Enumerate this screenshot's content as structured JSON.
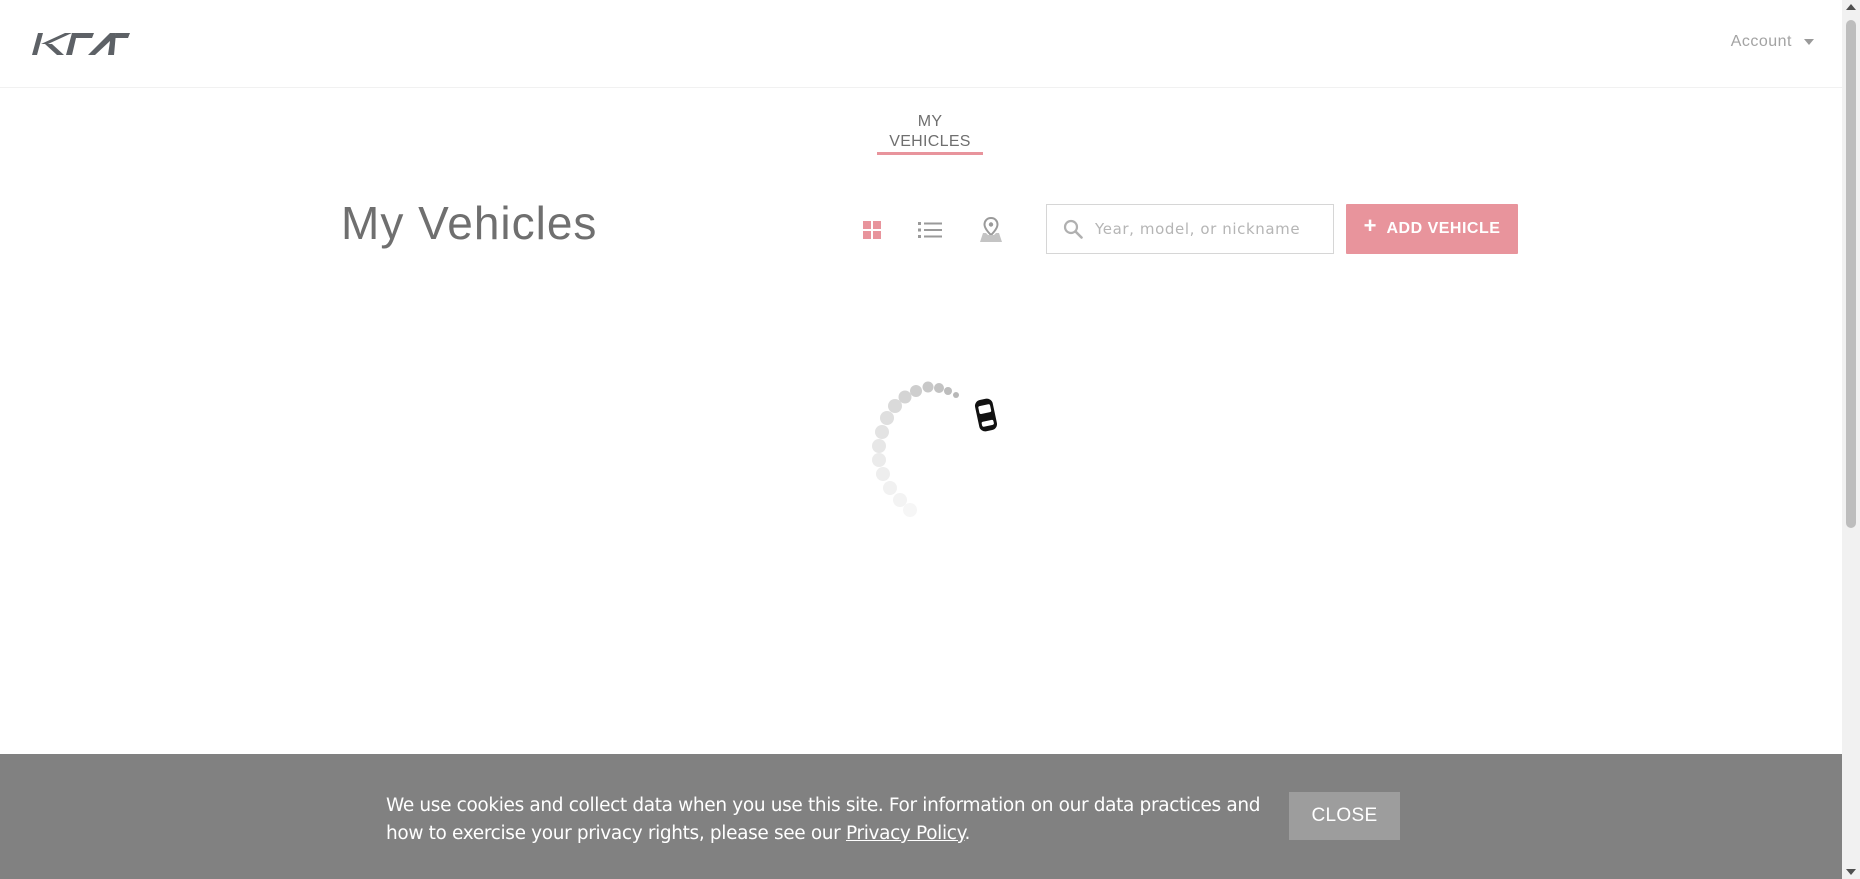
{
  "header": {
    "brand": "KIA",
    "account_label": "Account"
  },
  "tabs": [
    {
      "label": "MY VEHICLES",
      "active": true
    }
  ],
  "main": {
    "title": "My Vehicles",
    "view_modes": [
      {
        "name": "grid-view",
        "icon": "grid-icon",
        "active": true
      },
      {
        "name": "list-view",
        "icon": "list-icon",
        "active": false
      },
      {
        "name": "map-view",
        "icon": "map-pin-icon",
        "active": false
      }
    ],
    "search": {
      "placeholder": "Year, model, or nickname",
      "value": ""
    },
    "add_vehicle": {
      "icon": "+",
      "label": "ADD VEHICLE"
    },
    "loading": true
  },
  "cookie_banner": {
    "text_before_link": "We use cookies and collect data when you use this site. For information on our data practices and how to exercise your privacy rights, please see our ",
    "link_text": "Privacy Policy",
    "text_after_link": ".",
    "close_label": "CLOSE"
  },
  "colors": {
    "accent": "#e8949c",
    "banner_bg": "#818181",
    "close_bg": "#9d9d9d",
    "logo": "#5d6166",
    "text_muted": "#777777"
  }
}
